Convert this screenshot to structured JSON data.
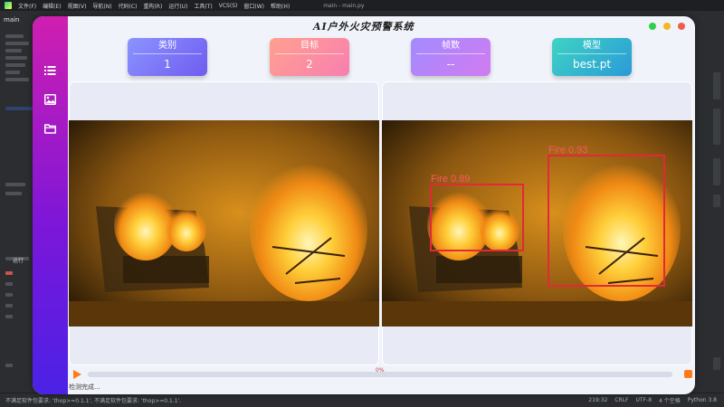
{
  "ide": {
    "project_tab": "main",
    "editor_title": "main - main.py",
    "menu": [
      "文件(F)",
      "编辑(E)",
      "视图(V)",
      "导航(N)",
      "代码(C)",
      "重构(R)",
      "运行(U)",
      "工具(T)",
      "VCS(S)",
      "窗口(W)",
      "帮助(H)"
    ],
    "run_label": "运行",
    "status_message": "不满足软件包要求: 'thop>=0.1.1', 不满足软件包要求: 'thop>=0.1.1'.",
    "status_right": {
      "position": "219:32",
      "line_ending": "CRLF",
      "encoding": "UTF-8",
      "indent": "4 个空格",
      "interpreter": "Python 3.8"
    }
  },
  "app": {
    "title": "AI户外火灾预警系统",
    "window_dot_colors": [
      "#2fcf4a",
      "#f6b524",
      "#ee5d4a"
    ],
    "sidebar_icons": [
      "list-icon",
      "image-icon",
      "folder-icon"
    ],
    "cards": [
      {
        "name": "category",
        "label": "类别",
        "value": "1",
        "gradient": [
          "#8b94ff",
          "#6f5cf0"
        ]
      },
      {
        "name": "target",
        "label": "目标",
        "value": "2",
        "gradient": [
          "#ffa08f",
          "#f87fb0"
        ]
      },
      {
        "name": "frames",
        "label": "帧数",
        "value": "--",
        "gradient": [
          "#a28bff",
          "#d27bf0"
        ]
      },
      {
        "name": "model",
        "label": "模型",
        "value": "best.pt",
        "gradient": [
          "#3fd3c4",
          "#2a9bd7"
        ]
      }
    ],
    "detections": [
      {
        "label": "Fire  0.89",
        "class": "Fire",
        "confidence": 0.89
      },
      {
        "label": "Fire  0.93",
        "class": "Fire",
        "confidence": 0.93
      }
    ],
    "progress": {
      "percent_text": "0%",
      "fraction": 0.0
    },
    "status_text": "检测完成...",
    "accent_color": "#ff7a1a",
    "box_color": "#e3283a"
  }
}
